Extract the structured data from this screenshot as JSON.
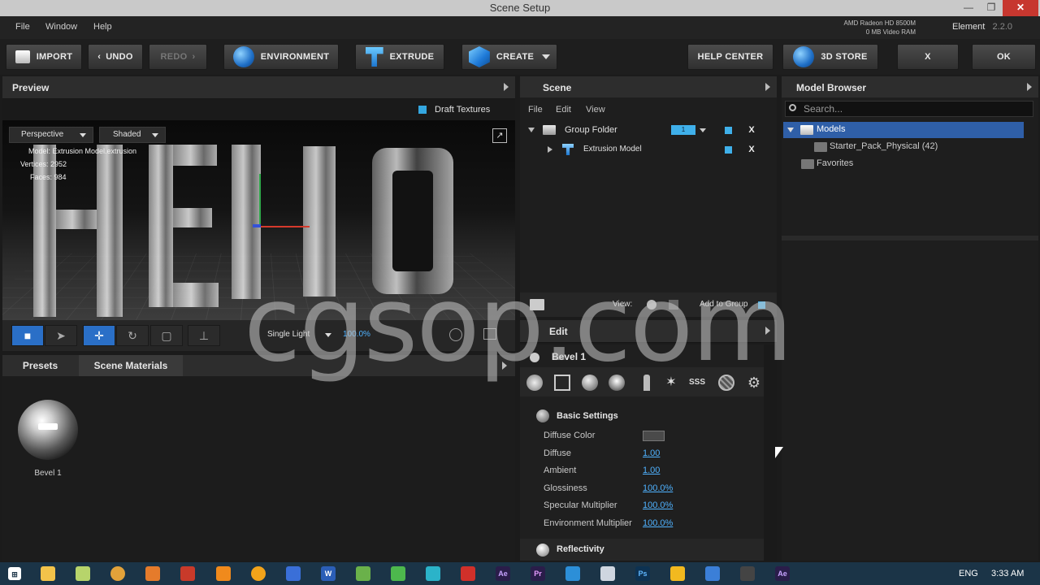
{
  "window": {
    "title": "Scene Setup",
    "controls": [
      "—",
      "❐",
      "✕"
    ]
  },
  "menu": {
    "items": [
      "File",
      "Window",
      "Help"
    ]
  },
  "gpu": {
    "name": "AMD Radeon HD 8500M",
    "memory": "0 MB Video RAM"
  },
  "brand": {
    "name": "Element",
    "version": "2.2.0"
  },
  "toolbar": {
    "import": "IMPORT",
    "undo": "UNDO",
    "redo": "REDO",
    "environment": "ENVIRONMENT",
    "extrude": "EXTRUDE",
    "create": "CREATE",
    "help_center": "HELP CENTER",
    "store": "3D STORE",
    "close": "X",
    "ok": "OK"
  },
  "preview": {
    "title": "Preview",
    "draft_textures": "Draft Textures",
    "camera_mode": "Perspective",
    "shading": "Shaded",
    "model_line": "Model:  Extrusion Model.extrusion",
    "vertices_line": "Vertices: 2952",
    "faces_line": "Faces: 984",
    "lighting": "Single Light",
    "zoom": "100.0%"
  },
  "bottom_left": {
    "tabs": [
      "Presets",
      "Scene Materials"
    ],
    "material_name": "Bevel 1"
  },
  "scene": {
    "title": "Scene",
    "menu": [
      "File",
      "Edit",
      "View"
    ],
    "items": [
      {
        "label": "Group Folder",
        "group_number": "1"
      },
      {
        "label": "Extrusion Model"
      }
    ],
    "view_label": "View:",
    "add_to_group": "Add to Group"
  },
  "edit": {
    "title": "Edit",
    "material": "Bevel 1",
    "section": "Basic Settings",
    "properties": [
      {
        "label": "Diffuse Color",
        "value": ""
      },
      {
        "label": "Diffuse",
        "value": "1.00"
      },
      {
        "label": "Ambient",
        "value": "1.00"
      },
      {
        "label": "Glossiness",
        "value": "100.0%"
      },
      {
        "label": "Specular Multiplier",
        "value": "100.0%"
      },
      {
        "label": "Environment Multiplier",
        "value": "100.0%"
      }
    ],
    "next_section": "Reflectivity"
  },
  "model_browser": {
    "title": "Model Browser",
    "search_placeholder": "Search...",
    "tree": {
      "root": "Models",
      "child": "Starter_Pack_Physical (42)",
      "favorites": "Favorites"
    }
  },
  "taskbar": {
    "language": "ENG",
    "time": "3:33 AM"
  },
  "watermark": "cgsop.com",
  "colors": {
    "accent": "#2a6fc7",
    "link": "#4fb2ff",
    "check": "#34a7e0"
  }
}
